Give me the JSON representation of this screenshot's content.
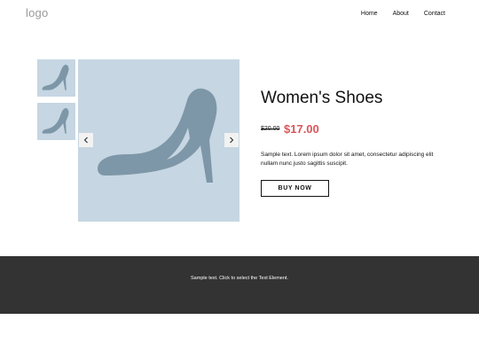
{
  "header": {
    "logo_text": "logo",
    "nav": [
      "Home",
      "About",
      "Contact"
    ]
  },
  "gallery": {
    "prev_icon": "chevron-left-icon",
    "next_icon": "chevron-right-icon",
    "image_bg": "#c6d6e2",
    "shoe_color": "#7d97a8"
  },
  "product": {
    "title": "Women's Shoes",
    "old_price": "$20.00",
    "new_price": "$17.00",
    "description": "Sample text. Lorem ipsum dolor sit amet, consectetur adipiscing elit nullam nunc justo sagittis suscipit.",
    "buy_label": "BUY NOW"
  },
  "footer": {
    "text": "Sample text. Click to select the Text Element."
  },
  "colors": {
    "accent": "#db545a",
    "footer_bg": "#333333"
  }
}
